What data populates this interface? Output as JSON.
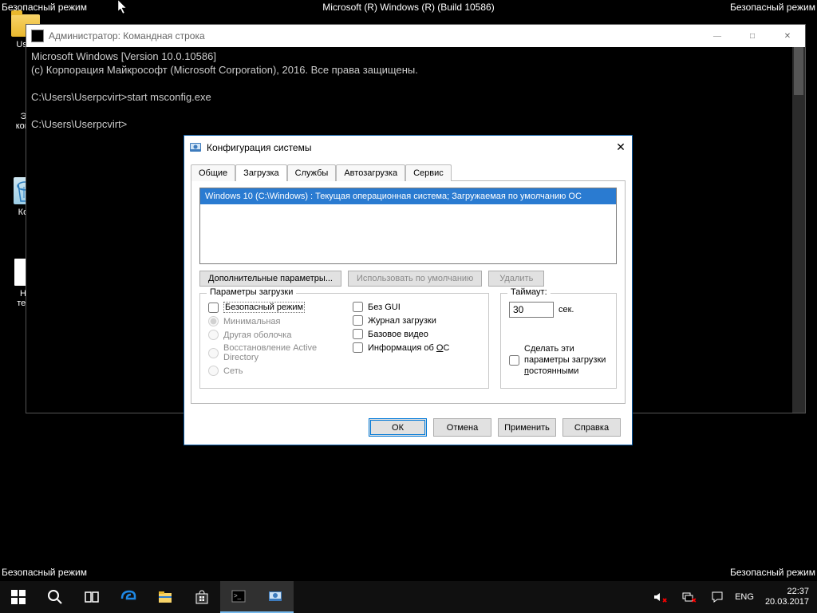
{
  "safemode_text": "Безопасный режим",
  "build_text": "Microsoft (R) Windows (R) (Build 10586)",
  "desktop_icons": {
    "user": "User",
    "this_pc_partial": "Эт",
    "this_pc_line2": "комп",
    "bin": "Кор",
    "txt1": "Но",
    "txt2": "текс"
  },
  "cmd": {
    "title": "Администратор: Командная строка",
    "line1": "Microsoft Windows [Version 10.0.10586]",
    "line2": "(c) Корпорация Майкрософт (Microsoft Corporation), 2016. Все права защищены.",
    "line3": "",
    "line4": "C:\\Users\\Userpcvirt>start msconfig.exe",
    "line5": "",
    "line6": "C:\\Users\\Userpcvirt>"
  },
  "msconfig": {
    "title": "Конфигурация системы",
    "tabs": [
      "Общие",
      "Загрузка",
      "Службы",
      "Автозагрузка",
      "Сервис"
    ],
    "os_entry": "Windows 10 (C:\\Windows) : Текущая операционная система; Загружаемая по умолчанию ОС",
    "btn_additional": "Дополнительные параметры...",
    "btn_set_default": "Использовать по умолчанию",
    "btn_delete": "Удалить",
    "group_boot": "Параметры загрузки",
    "safe_mode": "Безопасный режим",
    "r_min": "Минимальная",
    "r_shell": "Другая оболочка",
    "r_ad": "Восстановление Active Directory",
    "r_net": "Сеть",
    "cb_nogui": "Без GUI",
    "cb_bootlog": "Журнал загрузки",
    "cb_basevideo": "Базовое видео",
    "cb_osinfo_pre": "Информация  об ",
    "cb_osinfo_u": "О",
    "cb_osinfo_post": "С",
    "group_timeout": "Таймаут:",
    "timeout_value": "30",
    "timeout_unit": "сек.",
    "cb_permanent_pre": "Сделать эти параметры загрузки ",
    "cb_permanent_u": "п",
    "cb_permanent_post": "остоянными",
    "btn_ok": "ОК",
    "btn_cancel": "Отмена",
    "btn_apply": "Применить",
    "btn_help": "Справка"
  },
  "tray": {
    "lang": "ENG",
    "time": "22:37",
    "date": "20.03.2017"
  }
}
